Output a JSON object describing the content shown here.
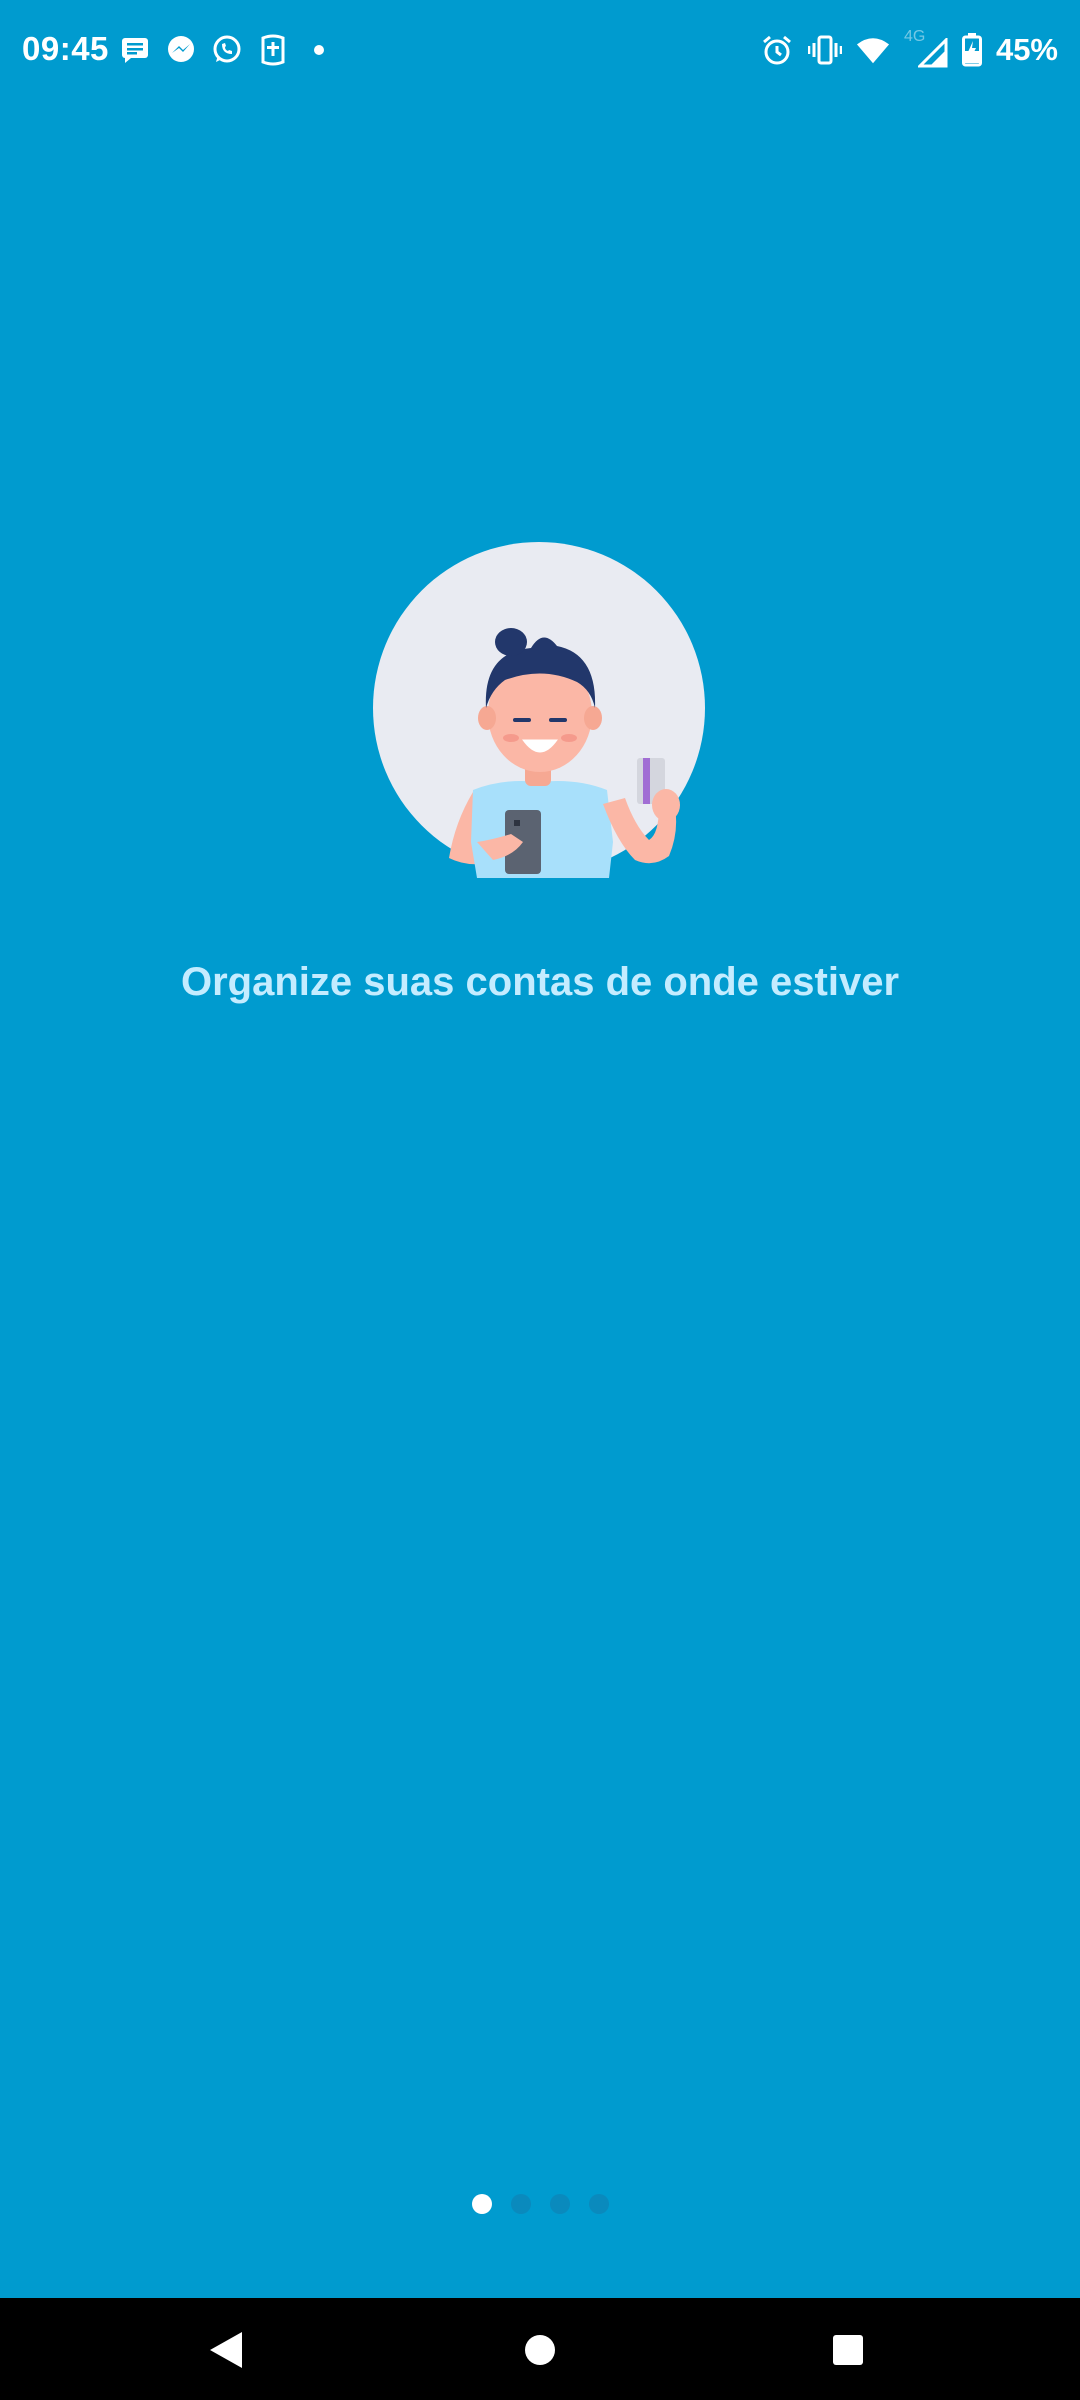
{
  "status_bar": {
    "time": "09:45",
    "battery": "45%",
    "network": "4G",
    "left_icons": [
      "sms-icon",
      "messenger-icon",
      "whatsapp-icon",
      "security-app-icon",
      "more-notifications-dot-icon"
    ],
    "right_icons": [
      "alarm-icon",
      "vibrate-icon",
      "wifi-icon",
      "signal-icon",
      "battery-charging-icon"
    ]
  },
  "onboarding": {
    "illustration": "person-with-phone-and-card-illustration",
    "headline": "Organize suas contas de onde estiver"
  },
  "pager": {
    "total": 4,
    "active_index": 0
  },
  "nav_bar": {
    "buttons": [
      "back-icon",
      "home-icon",
      "recents-icon"
    ]
  },
  "colors": {
    "background": "#009bcf",
    "headline": "#c4ecff",
    "pager_active": "#ffffff",
    "pager_inactive": "#0a8abd"
  }
}
